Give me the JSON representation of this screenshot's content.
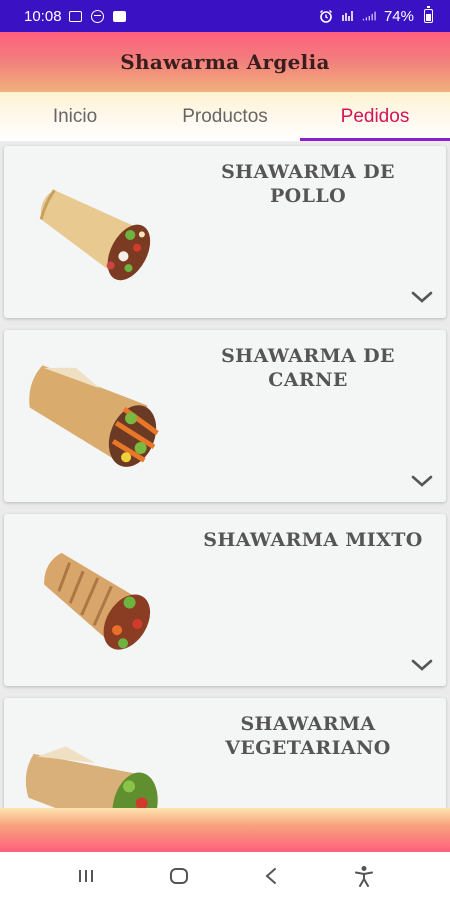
{
  "status_bar": {
    "time": "10:08",
    "battery": "74%",
    "icons": [
      "gallery-icon",
      "do-not-disturb-icon",
      "message-icon",
      "alarm-icon",
      "wifi-calling-icon",
      "signal-icon",
      "battery-icon"
    ]
  },
  "app": {
    "title": "Shawarma Argelia"
  },
  "tabs": [
    {
      "label": "Inicio",
      "active": false
    },
    {
      "label": "Productos",
      "active": false
    },
    {
      "label": "Pedidos",
      "active": true
    }
  ],
  "products": [
    {
      "name": "SHAWARMA DE POLLO",
      "line1": "SHAWARMA DE",
      "line2": "POLLO",
      "image": "chicken-shawarma-image"
    },
    {
      "name": "SHAWARMA DE CARNE",
      "line1": "SHAWARMA DE",
      "line2": "CARNE",
      "image": "beef-shawarma-image"
    },
    {
      "name": "SHAWARMA MIXTO",
      "line1": "SHAWARMA MIXTO",
      "line2": "",
      "image": "mixed-shawarma-image"
    },
    {
      "name": "SHAWARMA VEGETARIANO",
      "line1": "SHAWARMA",
      "line2": "VEGETARIANO",
      "image": "vegetarian-shawarma-image"
    }
  ],
  "colors": {
    "status_bar": "#3a12c4",
    "active_tab_text": "#d4145a",
    "tab_indicator": "#8a1fd0",
    "title_text": "#555555"
  },
  "nav": [
    "recent-apps-icon",
    "home-icon",
    "back-icon",
    "accessibility-icon"
  ]
}
